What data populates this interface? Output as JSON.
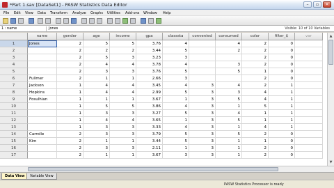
{
  "window": {
    "title": "*Part 1.sav [DataSet1] - PASW Statistics Data Editor",
    "minimize": "–",
    "maximize": "▫",
    "close": "✕"
  },
  "menu": [
    "File",
    "Edit",
    "View",
    "Data",
    "Transform",
    "Analyze",
    "Graphs",
    "Utilities",
    "Add-ons",
    "Window",
    "Help"
  ],
  "databar": {
    "cell_ref": "1 : name",
    "cell_value": "Jones",
    "visible_vars": "Visible: 10 of 10 Variables"
  },
  "columns": [
    "name",
    "gender",
    "age",
    "income",
    "gpa",
    "classsta",
    "convenied",
    "consumed",
    "color",
    "filter_$",
    "var"
  ],
  "rows": [
    {
      "n": "1",
      "cells": [
        "Jones",
        "2",
        "5",
        "5",
        "3.76",
        "4",
        "",
        "4",
        "2",
        "0"
      ]
    },
    {
      "n": "2",
      "cells": [
        "",
        "2",
        "2",
        "2",
        "3.44",
        "5",
        "",
        "2",
        "2",
        "0"
      ]
    },
    {
      "n": "3",
      "cells": [
        "",
        "2",
        "5",
        "3",
        "3.23",
        "3",
        "",
        "",
        "2",
        "0"
      ]
    },
    {
      "n": "4",
      "cells": [
        "",
        "2",
        "4",
        "4",
        "3.78",
        "4",
        "",
        "3",
        "2",
        "0"
      ]
    },
    {
      "n": "5",
      "cells": [
        "",
        "2",
        "3",
        "3",
        "3.76",
        "5",
        "",
        "5",
        "1",
        "0"
      ]
    },
    {
      "n": "6",
      "cells": [
        "Fullmer",
        "2",
        "1",
        "1",
        "2.66",
        "3",
        "",
        "",
        "2",
        "0"
      ]
    },
    {
      "n": "7",
      "cells": [
        "Jackson",
        "1",
        "4",
        "4",
        "3.45",
        "4",
        "3",
        "4",
        "2",
        "1"
      ]
    },
    {
      "n": "8",
      "cells": [
        "Hopkins",
        "1",
        "4",
        "4",
        "2.99",
        "5",
        "3",
        "3",
        "4",
        "1"
      ]
    },
    {
      "n": "9",
      "cells": [
        "Fosulhian",
        "1",
        "1",
        "1",
        "3.67",
        "1",
        "3",
        "5",
        "4",
        "1"
      ]
    },
    {
      "n": "10",
      "cells": [
        "",
        "1",
        "5",
        "5",
        "3.86",
        "4",
        "3",
        "1",
        "5",
        "1"
      ]
    },
    {
      "n": "11",
      "cells": [
        "",
        "1",
        "3",
        "3",
        "3.27",
        "5",
        "3",
        "4",
        "1",
        "1"
      ]
    },
    {
      "n": "12",
      "cells": [
        "",
        "1",
        "4",
        "4",
        "3.65",
        "1",
        "3",
        "5",
        "1",
        "1"
      ]
    },
    {
      "n": "13",
      "cells": [
        "",
        "1",
        "3",
        "3",
        "3.33",
        "4",
        "3",
        "1",
        "4",
        "1"
      ]
    },
    {
      "n": "14",
      "cells": [
        "Carrolle",
        "2",
        "3",
        "3",
        "3.79",
        "5",
        "3",
        "5",
        "2",
        "0"
      ]
    },
    {
      "n": "15",
      "cells": [
        "Kim",
        "2",
        "1",
        "1",
        "3.44",
        "5",
        "3",
        "1",
        "1",
        "0"
      ]
    },
    {
      "n": "16",
      "cells": [
        "",
        "2",
        "3",
        "3",
        "2.11",
        "1",
        "3",
        "1",
        "2",
        "0"
      ]
    },
    {
      "n": "17",
      "cells": [
        "",
        "2",
        "1",
        "1",
        "3.67",
        "3",
        "3",
        "1",
        "2",
        "0"
      ]
    }
  ],
  "tabs": [
    "Data View",
    "Variable View"
  ],
  "status": "PASW Statistics  Processor is ready",
  "colors": {
    "accent": "#2d5ba8",
    "active_tab": "#fff6c8"
  }
}
